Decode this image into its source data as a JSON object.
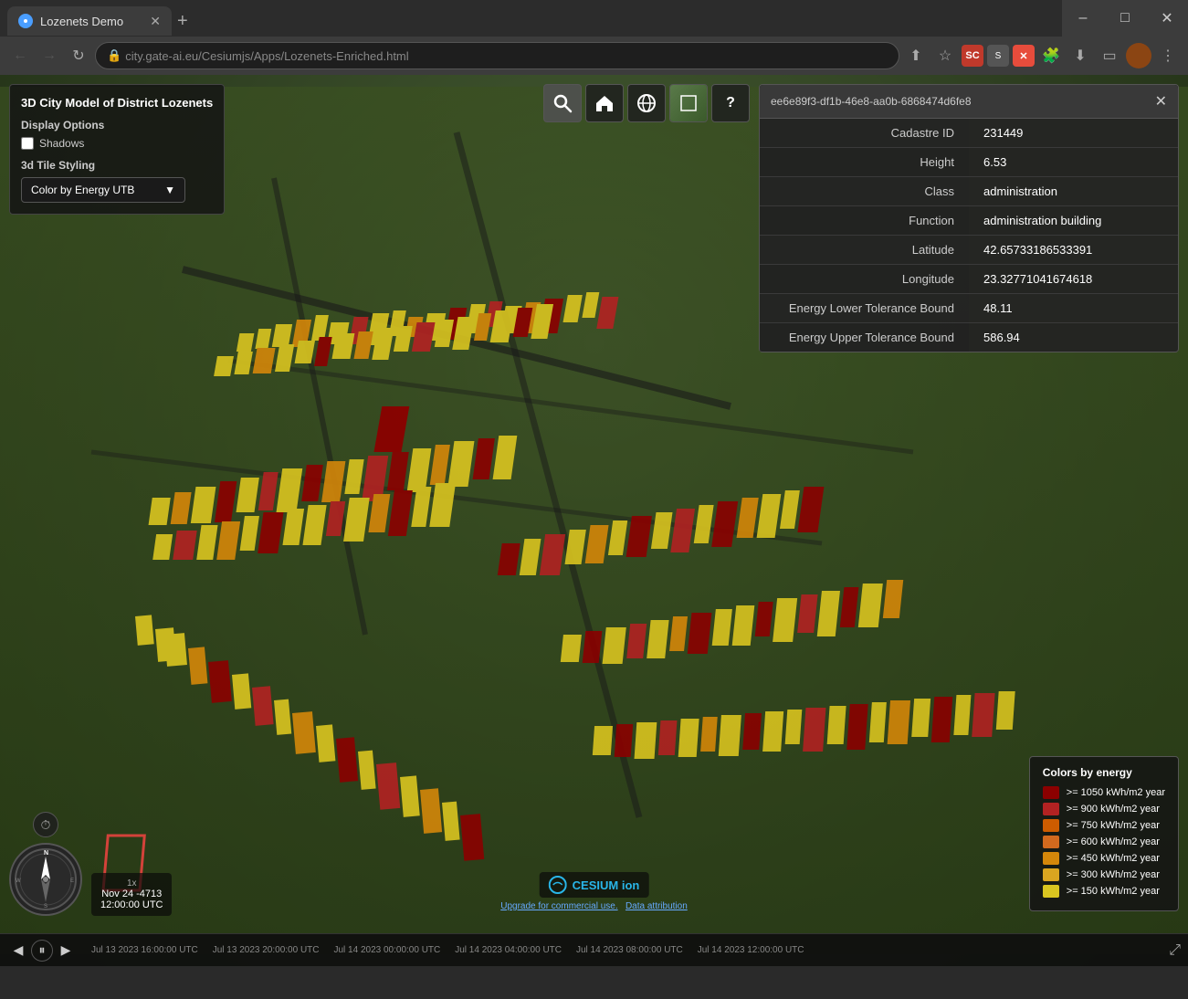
{
  "browser": {
    "tab_label": "Lozenets Demo",
    "url": "city.gate-ai.eu/Cesiumjs/Apps/Lozenets-Enriched.html",
    "new_tab_label": "+",
    "win_minimize": "–",
    "win_maximize": "□",
    "win_close": "✕"
  },
  "toolbar_buttons": {
    "search": "🔍",
    "home": "🏠",
    "globe": "🌐",
    "layers": "🗺",
    "help": "?"
  },
  "left_panel": {
    "title": "3D City Model of District Lozenets",
    "display_options_label": "Display Options",
    "shadows_label": "Shadows",
    "tile_styling_label": "3d Tile Styling",
    "dropdown_value": "Color by Energy UTB"
  },
  "info_panel": {
    "title": "ee6e89f3-df1b-46e8-aa0b-6868474d6fe8",
    "close_btn": "✕",
    "rows": [
      {
        "label": "Cadastre ID",
        "value": "231449"
      },
      {
        "label": "Height",
        "value": "6.53"
      },
      {
        "label": "Class",
        "value": "administration"
      },
      {
        "label": "Function",
        "value": "administration building"
      },
      {
        "label": "Latitude",
        "value": "42.65733186533391"
      },
      {
        "label": "Longitude",
        "value": "23.32771041674618"
      },
      {
        "label": "Energy Lower Tolerance Bound",
        "value": "48.11"
      },
      {
        "label": "Energy Upper Tolerance Bound",
        "value": "586.94"
      }
    ]
  },
  "legend": {
    "title": "Colors by energy",
    "items": [
      {
        "label": ">= 1050 kWh/m2 year",
        "color": "#8B0000"
      },
      {
        "label": ">= 900 kWh/m2 year",
        "color": "#B22222"
      },
      {
        "label": ">= 750 kWh/m2 year",
        "color": "#CD5C00"
      },
      {
        "label": ">= 600 kWh/m2 year",
        "color": "#D2691E"
      },
      {
        "label": ">= 450 kWh/m2 year",
        "color": "#D4870A"
      },
      {
        "label": ">= 300 kWh/m2 year",
        "color": "#DAA520"
      },
      {
        "label": ">= 150 kWh/m2 year",
        "color": "#DAC520"
      }
    ]
  },
  "timeline": {
    "prev_label": "◀",
    "play_label": "⏸",
    "next_label": "▶",
    "timestamps": [
      "Jul 13 2023 16:00:00 UTC",
      "Jul 13 2023 20:00:00 UTC",
      "Jul 14 2023 00:00:00 UTC",
      "Jul 14 2023 04:00:00 UTC",
      "Jul 14 2023 08:00:00 UTC",
      "Jul 14 2023 12:00:00 UTC"
    ]
  },
  "time_display": {
    "speed": "1x",
    "date_line1": "Nov 24 -4713",
    "date_line2": "12:00:00 UTC"
  },
  "cesium": {
    "logo_text": "CESIUM ion",
    "upgrade_link": "Upgrade for commercial use.",
    "attribution_link": "Data attribution"
  }
}
